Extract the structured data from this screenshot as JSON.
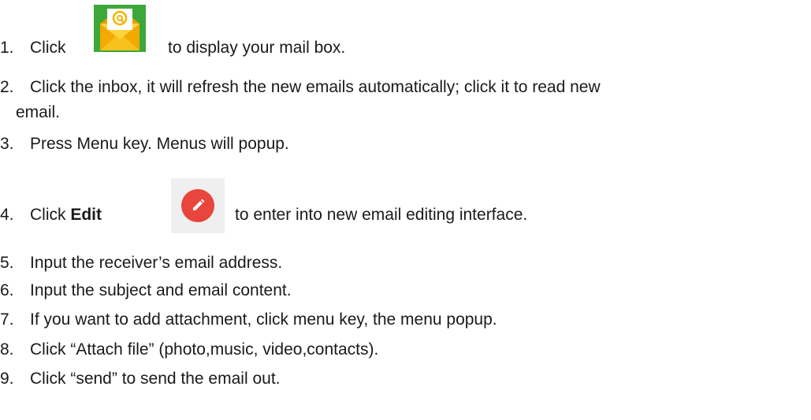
{
  "steps": [
    {
      "num": "1.",
      "before": "Click",
      "after": "to display your mail box.",
      "icon": "email-app-icon"
    },
    {
      "num": "2.",
      "text": "Click the inbox, it will refresh the new emails automatically; click it to read new",
      "cont": "email."
    },
    {
      "num": "3.",
      "text": "Press Menu key. Menus will popup."
    },
    {
      "num": "4.",
      "before": "Click",
      "bold": "Edit",
      "after": "to enter into new email editing interface.",
      "icon": "edit-pencil-icon"
    },
    {
      "num": "5.",
      "text": "Input the receiver’s email address."
    },
    {
      "num": "6.",
      "text": "Input the subject and email content."
    },
    {
      "num": "7.",
      "text": "If you want to add attachment, click menu key, the menu popup."
    },
    {
      "num": "8.",
      "text": "Click “Attach file” (photo,music, video,contacts)."
    },
    {
      "num": "9.",
      "text": "Click “send” to send the email out."
    }
  ],
  "colors": {
    "mail_icon_yellow": "#f5b400",
    "mail_icon_green": "#3da83a",
    "edit_button_red": "#e8453c"
  }
}
